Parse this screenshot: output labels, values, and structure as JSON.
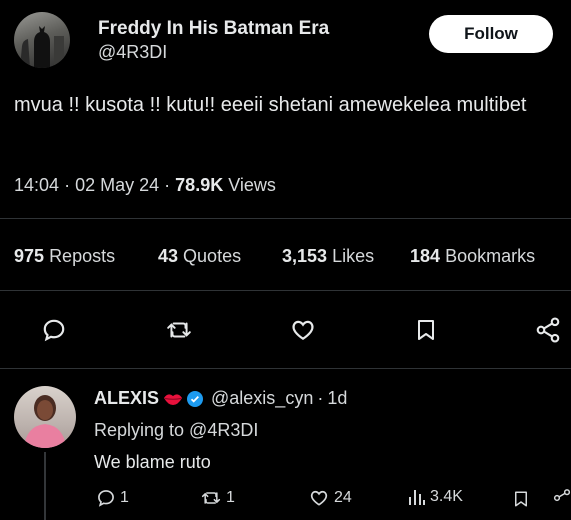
{
  "tweet": {
    "author_name": "Freddy In His Batman Era",
    "author_handle": "@4R3DI",
    "follow_label": "Follow",
    "text": "mvua !! kusota !! kutu!! eeeii shetani amewekelea multibet",
    "time": "14:04",
    "date": "02 May 24",
    "views_count": "78.9K",
    "views_label": "Views",
    "dot": "·"
  },
  "stats": {
    "reposts_count": "975",
    "reposts_label": "Reposts",
    "quotes_count": "43",
    "quotes_label": "Quotes",
    "likes_count": "3,153",
    "likes_label": "Likes",
    "bookmarks_count": "184",
    "bookmarks_label": "Bookmarks"
  },
  "actions": [
    "reply-icon",
    "retweet-icon",
    "like-icon",
    "bookmark-icon",
    "share-icon"
  ],
  "reply": {
    "author_name": "ALEXIS",
    "author_handle": "@alexis_cyn",
    "age": "1d",
    "dot": "·",
    "replying_to": "Replying to @4R3DI",
    "text": "We blame ruto",
    "reply_count": "1",
    "retweet_count": "1",
    "like_count": "24",
    "views_count": "3.4K"
  },
  "colors": {
    "background": "#000000",
    "text": "#e7e9ea",
    "divider": "#2f3336",
    "verified": "#1d9bf0",
    "lips": "#f91880"
  }
}
